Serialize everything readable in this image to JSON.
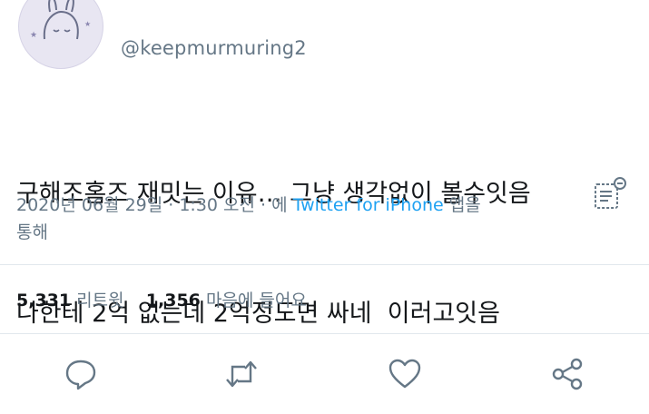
{
  "tweet": {
    "handle": "@keepmurmuring2",
    "text_line1": "구해조홈즈 재밋는 이유… 그냥 생각없이 볼수잇음",
    "text_line2": "나한테 2억 없는데 2억정도면 싸네  이러고잇음",
    "date": "2020년 06월 29일 · 1:30 오전 · 에 ",
    "source": "Twitter for iPhone",
    "source_suffix": " 앱을",
    "source_suffix2": "통해"
  },
  "stats": {
    "retweets_count": "5,331",
    "retweets_label": "리트윗",
    "likes_count": "1,356",
    "likes_label": "마음에 들어요"
  },
  "colors": {
    "accent": "#1da1f2",
    "secondary_text": "#657786",
    "divider": "#e1e8ed"
  },
  "icons": [
    "translate-icon",
    "reply-icon",
    "retweet-icon",
    "like-icon",
    "share-icon"
  ]
}
